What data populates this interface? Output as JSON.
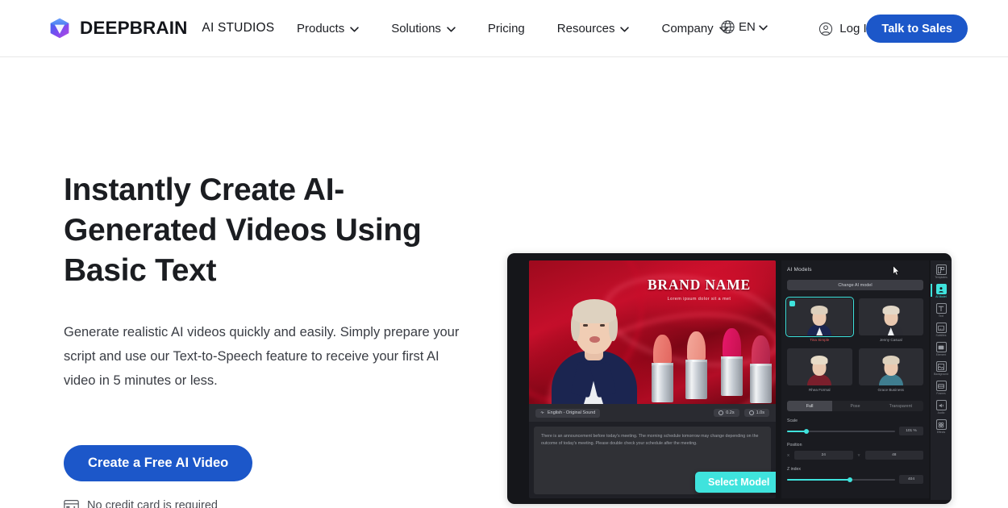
{
  "header": {
    "brand": {
      "name": "DEEPBRAIN",
      "sub": "AI STUDIOS",
      "logo_icon": "cube-logo-icon"
    },
    "nav_items": [
      {
        "label": "Products",
        "has_dropdown": true
      },
      {
        "label": "Solutions",
        "has_dropdown": true
      },
      {
        "label": "Pricing",
        "has_dropdown": false
      },
      {
        "label": "Resources",
        "has_dropdown": true
      },
      {
        "label": "Company",
        "has_dropdown": true
      }
    ],
    "language": {
      "label": "EN",
      "icon": "globe-icon"
    },
    "login": {
      "label": "Log In",
      "icon": "user-circle-icon"
    },
    "cta": {
      "label": "Talk to Sales"
    }
  },
  "hero": {
    "title": "Instantly Create AI-Generated Videos Using Basic Text",
    "description": "Generate realistic AI videos quickly and easily. Simply prepare your script and use our Text-to-Speech feature to receive your first AI video in 5 minutes or less.",
    "cta_label": "Create a Free AI Video",
    "note": "No credit card is required",
    "note_icon": "credit-card-icon"
  },
  "app_mock": {
    "video": {
      "brand_title": "BRAND NAME",
      "brand_subtitle": "Lorem ipsum dolor sit a met"
    },
    "voice_bar": {
      "voice_chip": "English - Original Sound",
      "duration_chip": "0.2s",
      "total_chip": "1.0s"
    },
    "script_text": "There is an announcement before today's meeting. The morning schedule tomorrow may change depending on the outcome of today's meeting. Please double check your schedule after the meeting.",
    "tooltip": {
      "label": "Select Model"
    },
    "panel": {
      "title": "AI Models",
      "change_button": "Change AI model",
      "models": [
        {
          "label": "Tina Simple",
          "selected": true
        },
        {
          "label": "Jenny Casual",
          "selected": false
        },
        {
          "label": "Rhea Formal",
          "selected": false
        },
        {
          "label": "Grace Business",
          "selected": false
        }
      ],
      "tabs": [
        {
          "label": "Full",
          "active": true
        },
        {
          "label": "Pose",
          "active": false
        },
        {
          "label": "Transparent",
          "active": false
        }
      ],
      "controls": [
        {
          "name": "Scale",
          "value": "101 %"
        },
        {
          "name": "Position",
          "x": "24",
          "y": "48"
        },
        {
          "name": "Z index",
          "value": "404"
        }
      ]
    },
    "rail": [
      {
        "label": "Templates",
        "icon": "templates-icon",
        "active": false
      },
      {
        "label": "AI Model",
        "icon": "ai-model-icon",
        "active": true
      },
      {
        "label": "Text",
        "icon": "text-icon",
        "active": false
      },
      {
        "label": "Subtitles",
        "icon": "subtitles-icon",
        "active": false
      },
      {
        "label": "Element",
        "icon": "element-icon",
        "active": false
      },
      {
        "label": "Background",
        "icon": "background-icon",
        "active": false
      },
      {
        "label": "Frames",
        "icon": "frames-icon",
        "active": false
      },
      {
        "label": "Audio",
        "icon": "audio-icon",
        "active": false
      },
      {
        "label": "Effects",
        "icon": "effects-icon",
        "active": false
      }
    ]
  },
  "colors": {
    "brand_blue": "#1c57c9",
    "accent_cyan": "#3fe3dd",
    "text_dark": "#1b1d21",
    "app_bg": "#15161a"
  }
}
